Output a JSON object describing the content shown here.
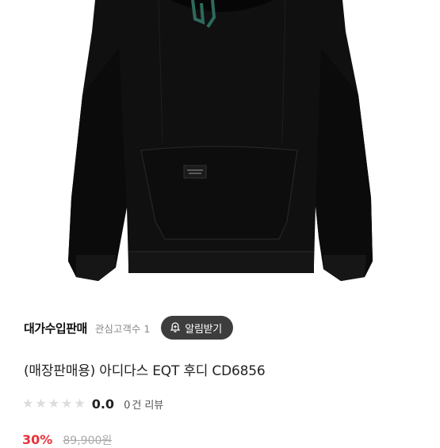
{
  "product": {
    "image_alt": "black hoodie product image",
    "title": "(매장판매용) 아디다스 EQT 후디 CD6856"
  },
  "store": {
    "name": "대가수입판매",
    "followers_label": "관심고객수",
    "followers_count": "1",
    "notify_button": "알림받기"
  },
  "rating": {
    "score": "0.0",
    "stars": 5,
    "filled_stars": 0,
    "review_count": "0",
    "review_unit": "건",
    "review_label": "리뷰"
  },
  "price": {
    "discount": "30%",
    "original": "89,900원"
  },
  "colors": {
    "notify_bg": "#3d3d3d",
    "star_empty": "#dcdcdc",
    "discount": "#e8303a"
  }
}
